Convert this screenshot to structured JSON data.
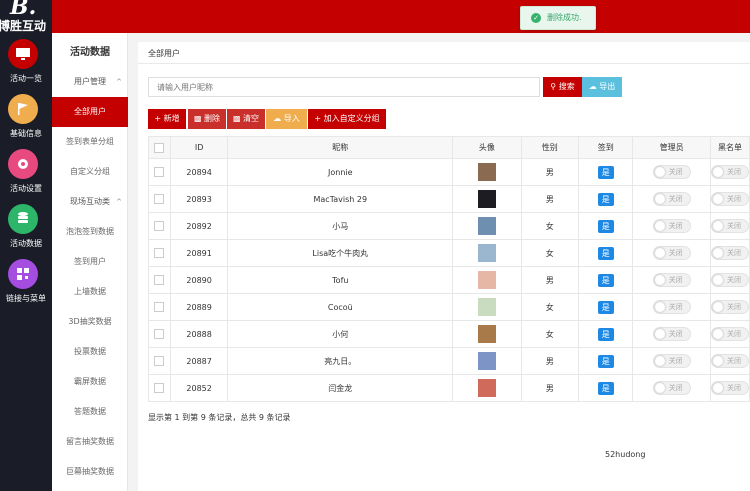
{
  "app": {
    "logo_mark": "B.",
    "logo_text": "博胜互动",
    "accent": "#c40000"
  },
  "leftnav": [
    {
      "label": "活动一览",
      "icon": "monitor-icon",
      "color": "#c40000"
    },
    {
      "label": "基础信息",
      "icon": "flag-icon",
      "color": "#f0ad4e"
    },
    {
      "label": "活动设置",
      "icon": "gear-icon",
      "color": "#e84a7f"
    },
    {
      "label": "活动数据",
      "icon": "database-icon",
      "color": "#2db56a"
    },
    {
      "label": "链接与菜单",
      "icon": "qrcode-icon",
      "color": "#a44de0"
    }
  ],
  "subnav": {
    "title": "活动数据",
    "items": [
      {
        "label": "用户管理",
        "group": true
      },
      {
        "label": "全部用户",
        "active": true
      },
      {
        "label": "签到表单分组"
      },
      {
        "label": "自定义分组"
      },
      {
        "label": "现场互动类",
        "group": true
      },
      {
        "label": "泡泡签到数据"
      },
      {
        "label": "签到用户"
      },
      {
        "label": "上墙数据"
      },
      {
        "label": "3D抽奖数据"
      },
      {
        "label": "投票数据"
      },
      {
        "label": "霸屏数据"
      },
      {
        "label": "答题数据"
      },
      {
        "label": "留言抽奖数据"
      },
      {
        "label": "巨幕抽奖数据"
      }
    ]
  },
  "toast": {
    "message": "删除成功."
  },
  "panel": {
    "title": "全部用户",
    "search_placeholder": "请输入用户昵称",
    "search_label": "搜索",
    "export_label": "导出",
    "toolbar": {
      "add": "新增",
      "delete": "删除",
      "clear": "清空",
      "import": "导入",
      "add_group": "加入自定义分组"
    },
    "columns": [
      "ID",
      "昵称",
      "头像",
      "性别",
      "签到",
      "管理员",
      "黑名单"
    ],
    "rows": [
      {
        "id": "20894",
        "nickname": "Jonnie",
        "gender": "男",
        "sign": "是",
        "admin": "关闭",
        "blacklist": "关闭",
        "avatar_color": "#8a6b52"
      },
      {
        "id": "20893",
        "nickname": "MacTavish 29",
        "gender": "男",
        "sign": "是",
        "admin": "关闭",
        "blacklist": "关闭",
        "avatar_color": "#1c1c22"
      },
      {
        "id": "20892",
        "nickname": "小马",
        "gender": "女",
        "sign": "是",
        "admin": "关闭",
        "blacklist": "关闭",
        "avatar_color": "#6f8fb0"
      },
      {
        "id": "20891",
        "nickname": "Lisa吃个牛肉丸",
        "gender": "女",
        "sign": "是",
        "admin": "关闭",
        "blacklist": "关闭",
        "avatar_color": "#9bb7cf"
      },
      {
        "id": "20890",
        "nickname": "Tofu",
        "gender": "男",
        "sign": "是",
        "admin": "关闭",
        "blacklist": "关闭",
        "avatar_color": "#e6b7a5"
      },
      {
        "id": "20889",
        "nickname": "Cocoü",
        "gender": "女",
        "sign": "是",
        "admin": "关闭",
        "blacklist": "关闭",
        "avatar_color": "#c9dcc0"
      },
      {
        "id": "20888",
        "nickname": "小何",
        "gender": "女",
        "sign": "是",
        "admin": "关闭",
        "blacklist": "关闭",
        "avatar_color": "#a87a4a"
      },
      {
        "id": "20887",
        "nickname": "亮九日。",
        "gender": "男",
        "sign": "是",
        "admin": "关闭",
        "blacklist": "关闭",
        "avatar_color": "#7c95c6"
      },
      {
        "id": "20852",
        "nickname": "闫金龙",
        "gender": "男",
        "sign": "是",
        "admin": "关闭",
        "blacklist": "关闭",
        "avatar_color": "#d06a5a"
      }
    ],
    "footer": "显示第 1 到第 9 条记录，总共 9 条记录",
    "watermark": "52hudong"
  }
}
